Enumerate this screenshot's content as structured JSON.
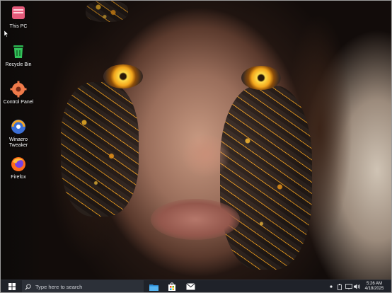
{
  "desktop": {
    "icons": [
      {
        "label": "This PC",
        "icon": "this-pc-icon"
      },
      {
        "label": "Recycle Bin",
        "icon": "recycle-bin-icon"
      },
      {
        "label": "Control Panel",
        "icon": "control-panel-icon"
      },
      {
        "label": "Winaero Tweaker",
        "icon": "winaero-tweaker-icon"
      },
      {
        "label": "Firefox",
        "icon": "firefox-icon"
      }
    ]
  },
  "taskbar": {
    "search_placeholder": "Type here to search",
    "pinned": [
      {
        "name": "File Explorer",
        "icon": "file-explorer-icon"
      },
      {
        "name": "Microsoft Store",
        "icon": "store-icon"
      },
      {
        "name": "Mail",
        "icon": "mail-icon"
      }
    ],
    "time": "5:26 AM",
    "date": "4/18/2025"
  },
  "colors": {
    "taskbar_bg": "#1f2229",
    "search_bg": "#2c3038",
    "accent_blue": "#1e90ff",
    "this_pc_pink": "#e45a7a",
    "recycle_green": "#33c25a"
  }
}
